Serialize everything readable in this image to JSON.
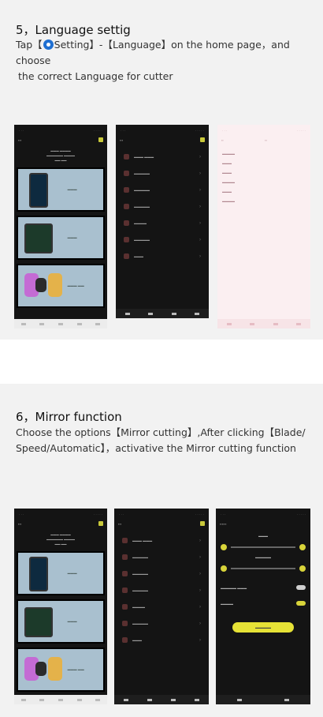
{
  "section5": {
    "heading": "5，Language settig",
    "line1_pre": "Tap【",
    "line1_post": "Setting】-【Language】on the home page，and choose",
    "line2": "the correct Language for cutter",
    "setting_icon": "gear-icon"
  },
  "section6": {
    "heading": "6，Mirror function",
    "line1": "Choose the options【Mirror cutting】,After clicking【Blade/",
    "line2": "Speed/Automatic】，activative the Mirror cutting function"
  },
  "colors": {
    "panel_bg": "#f2f2f2",
    "screen_dark": "#141414",
    "screen_pink": "#fbeff1",
    "accent_yellow": "#e6e236",
    "icon_blue": "#1f6fd1"
  }
}
